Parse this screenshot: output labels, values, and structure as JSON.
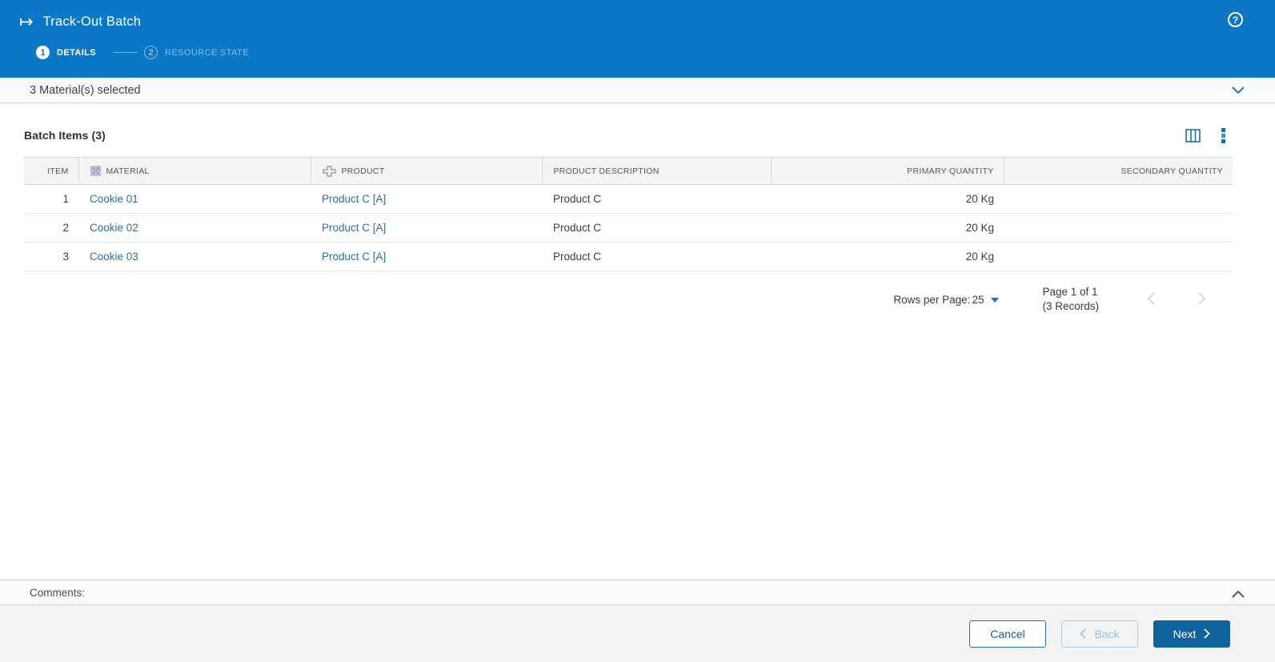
{
  "header": {
    "title": "Track-Out Batch",
    "trackout_icon_glyph": "↦",
    "help_icon_glyph": "?",
    "steps": [
      {
        "number": "1",
        "label": "DETAILS"
      },
      {
        "number": "2",
        "label": "RESOURCE STATE"
      }
    ]
  },
  "materials_bar": {
    "label": "3 Material(s) selected"
  },
  "batch_items": {
    "title": "Batch Items (3)",
    "columns": {
      "item": "ITEM",
      "material": "MATERIAL",
      "product": "PRODUCT",
      "product_description": "PRODUCT DESCRIPTION",
      "primary_quantity": "PRIMARY QUANTITY",
      "secondary_quantity": "SECONDARY QUANTITY"
    },
    "rows": [
      {
        "item": "1",
        "material": "Cookie 01",
        "product": "Product C [A]",
        "product_description": "Product C",
        "primary_quantity": "20 Kg",
        "secondary_quantity": ""
      },
      {
        "item": "2",
        "material": "Cookie 02",
        "product": "Product C [A]",
        "product_description": "Product C",
        "primary_quantity": "20 Kg",
        "secondary_quantity": ""
      },
      {
        "item": "3",
        "material": "Cookie 03",
        "product": "Product C [A]",
        "product_description": "Product C",
        "primary_quantity": "20 Kg",
        "secondary_quantity": ""
      }
    ]
  },
  "pagination": {
    "rows_per_page_label": "Rows per Page:",
    "rows_per_page_value": "25",
    "page_info": "Page 1 of 1",
    "records_info": "(3 Records)"
  },
  "comments": {
    "label": "Comments:"
  },
  "footer": {
    "cancel_label": "Cancel",
    "back_label": "Back",
    "next_label": "Next"
  },
  "colors": {
    "header_blue": "#0a77c7",
    "link_blue": "#2e6e9e",
    "next_button_blue": "#0e639c",
    "inactive_step_blue": "#85bce3",
    "material_icon_purple": "#c7b6d9"
  }
}
